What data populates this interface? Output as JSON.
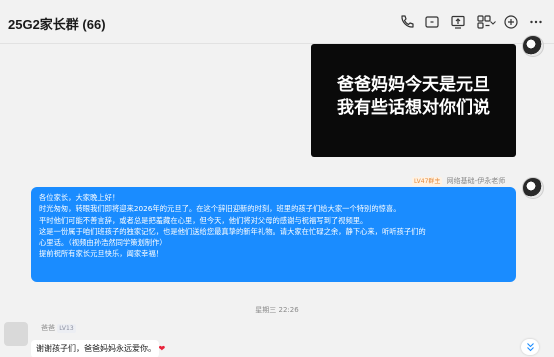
{
  "header": {
    "title": "25G2家长群 (66)",
    "icons": [
      "phone-icon",
      "video-call-icon",
      "screen-share-icon",
      "apps-icon",
      "add-icon",
      "more-icon"
    ]
  },
  "messages": {
    "video": {
      "line1": "爸爸妈妈今天是元旦",
      "line2": "我有些话想对你们说"
    },
    "teacher": {
      "badge": "LV47群主",
      "name": "网络基础-伊永老师",
      "lines": [
        "各位家长，大家晚上好！",
        "时光匆匆，转眼我们即将迎来2026年的元旦了。在这个辞旧迎新的时刻，班里的孩子们给大家一个特别的惊喜。",
        "平时他们可能不善言辞，或者总是把羞藏在心里，但今天，他们将对父母的感谢与祝福写到了视频里。",
        "这是一份属于咱们班孩子的独家记忆，也是他们送给您最真挚的新年礼物。请大家在忙碌之余，静下心来，听听孩子们的",
        "心里话。（视频由孙浩然同学策划制作）",
        "提前祝所有家长元旦快乐，阖家幸福！"
      ]
    },
    "timestamp": "星期三 22:26",
    "parent": {
      "name": "爸爸",
      "badge": "LV13",
      "text": "谢谢孩子们，爸爸妈妈永远爱你。",
      "emoji": "❤"
    }
  },
  "colors": {
    "blue_bubble": "#1a8cff",
    "background": "#f2f2f2"
  }
}
